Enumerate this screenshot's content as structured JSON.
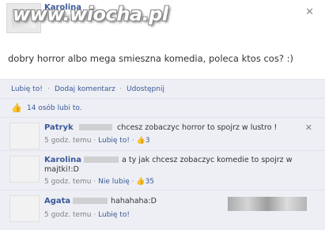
{
  "watermark": "www.wiocha.pl",
  "post": {
    "author": "Karolina",
    "text": "dobry horror albo mega smieszna komedia, poleca ktos cos? :)",
    "close_icon": "close-icon"
  },
  "actions": {
    "like": "Lubię to!",
    "separator": "·",
    "comment": "Dodaj komentarz",
    "share": "Udostępnij"
  },
  "likes": {
    "icon": "thumbs-up-icon",
    "text": "14 osób lubi to."
  },
  "comments": [
    {
      "author": "Patryk",
      "text": "chcesz zobaczyc horror to spojrz w lustro !",
      "time": "5 godz. temu",
      "sep": "·",
      "like_label": "Lubię to!",
      "like_count": "3"
    },
    {
      "author": "Karolina",
      "text_line1": "a ty jak chcesz zobaczyc komedie to spojrz w",
      "text_line2": "majtki!:D",
      "time": "5 godz. temu",
      "sep": "·",
      "like_label": "Nie lubię",
      "like_count": "35"
    },
    {
      "author": "Agata",
      "text": "hahahaha:D",
      "time": "5 godz. temu",
      "sep": "·",
      "like_label": "Lubię to!"
    }
  ]
}
